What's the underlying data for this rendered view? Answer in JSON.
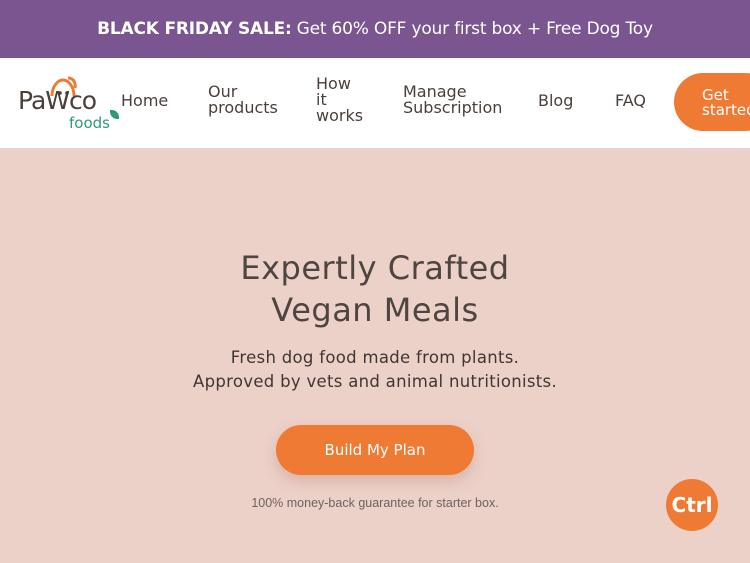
{
  "promo": {
    "bold": "BLACK FRIDAY SALE:",
    "text": "Get 60% OFF your first box + Free Dog Toy"
  },
  "brand": {
    "logo_main": "PaWco",
    "logo_sub": "foods",
    "colors": {
      "orange": "#ef7a33",
      "green": "#2f9a78",
      "purple": "#7a5590",
      "hero_bg": "#ecd1c9"
    }
  },
  "nav": {
    "home": "Home",
    "products": [
      "Our",
      "products"
    ],
    "how": [
      "How",
      "it",
      "works"
    ],
    "manage": [
      "Manage",
      "Subscription"
    ],
    "blog": "Blog",
    "faq": "FAQ",
    "get_started": [
      "Get",
      "started"
    ]
  },
  "hero": {
    "title": [
      "Expertly Crafted",
      "Vegan Meals"
    ],
    "subtitle": [
      "Fresh dog food made from plants.",
      "Approved by vets and animal nutritionists."
    ],
    "cta": "Build My Plan",
    "guarantee": "100% money-back guarantee for starter box."
  },
  "ctrl_badge": "Ctrl"
}
